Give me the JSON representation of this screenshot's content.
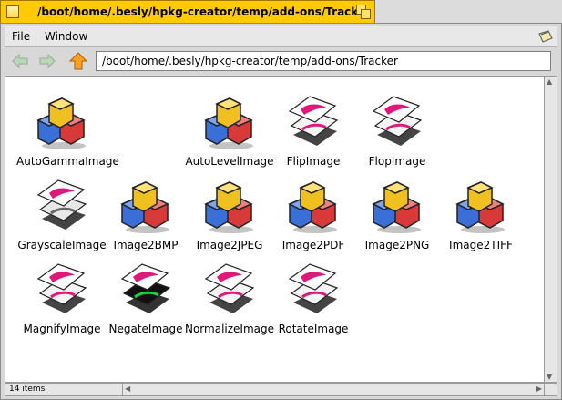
{
  "window": {
    "title": "/boot/home/.besly/hpkg-creator/temp/add-ons/Tracker",
    "accent": "#ffcb00"
  },
  "menubar": {
    "items": [
      "File",
      "Window"
    ]
  },
  "toolbar": {
    "back_icon": "arrow-left-icon",
    "forward_icon": "arrow-right-icon",
    "up_icon": "arrow-up-icon",
    "path": "/boot/home/.besly/hpkg-creator/temp/add-ons/Tracker"
  },
  "files": [
    {
      "name": "AutoGammaImage",
      "icon": "cubes"
    },
    {
      "name": "AutoLevelImage",
      "icon": "cubes"
    },
    {
      "name": "FlipImage",
      "icon": "pages"
    },
    {
      "name": "FlopImage",
      "icon": "pages"
    },
    {
      "name": "GrayscaleImage",
      "icon": "pages-gray"
    },
    {
      "name": "Image2BMP",
      "icon": "cubes"
    },
    {
      "name": "Image2JPEG",
      "icon": "cubes"
    },
    {
      "name": "Image2PDF",
      "icon": "cubes"
    },
    {
      "name": "Image2PNG",
      "icon": "cubes"
    },
    {
      "name": "Image2TIFF",
      "icon": "cubes"
    },
    {
      "name": "MagnifyImage",
      "icon": "pages"
    },
    {
      "name": "NegateImage",
      "icon": "pages-negative"
    },
    {
      "name": "NormalizeImage",
      "icon": "pages"
    },
    {
      "name": "RotateImage",
      "icon": "pages"
    }
  ],
  "status": {
    "count": "14 items"
  }
}
